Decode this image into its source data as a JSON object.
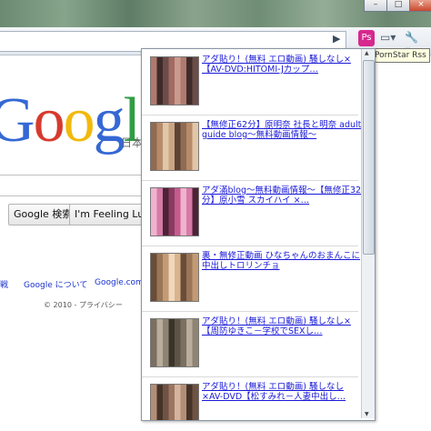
{
  "browser": {
    "tooltip": "PornStar Rss",
    "ext_icon_glyph": "Ps",
    "go_icon": "go-arrow-icon",
    "page_icon": "page-menu-icon",
    "wrench_icon": "wrench-icon"
  },
  "google": {
    "logo": "Google",
    "subtitle": "日本",
    "search_button": "Google 検索",
    "lucky_button": "I'm Feeling Lucky",
    "link_left": "戦",
    "link_about": "Google について",
    "link_com": "Google.com",
    "copyright": "© 2010 - プライバシー"
  },
  "feed": {
    "items": [
      {
        "title": "アダ貼り！(無料 エロ動画) 騒しなし×【AV-DVD:HITOMI-Jカップ…",
        "palette": [
          "#b07a6f",
          "#6b4c48",
          "#c99b8e",
          "#3f2c2a",
          "#a26a63"
        ]
      },
      {
        "title": "【無修正62分】原明奈 社長と明奈 adult guide blog～無料動画情報～",
        "palette": [
          "#c9a583",
          "#8f6b52",
          "#e1c6a8",
          "#5c4334",
          "#b78b6a"
        ]
      },
      {
        "title": "アダ滿blog～無料動画情報～【無修正32分】原小雪 スカイハイ ×…",
        "palette": [
          "#d67aa6",
          "#8a3a62",
          "#f0b3cf",
          "#4d2236",
          "#c45c8d"
        ]
      },
      {
        "title": "裏・無修正動画 ひなちゃんのおまんこに中出しトロリンチョ",
        "palette": [
          "#d8b48e",
          "#9a7657",
          "#f0d8bc",
          "#6a4d38",
          "#c29a74"
        ]
      },
      {
        "title": "アダ貼り！(無料 エロ動画) 騒しなし×【周防ゆきこ－学校でSEXし…",
        "palette": [
          "#8f8474",
          "#5d5446",
          "#b9ad9c",
          "#3a332a",
          "#7a6f61"
        ]
      },
      {
        "title": "アダ貼り！(無料 エロ動画) 騒しなし×AV-DVD【松すみれ－人妻中出し…",
        "palette": [
          "#b38e77",
          "#6e5344",
          "#d4b49d",
          "#463328",
          "#9c7560"
        ]
      }
    ]
  }
}
